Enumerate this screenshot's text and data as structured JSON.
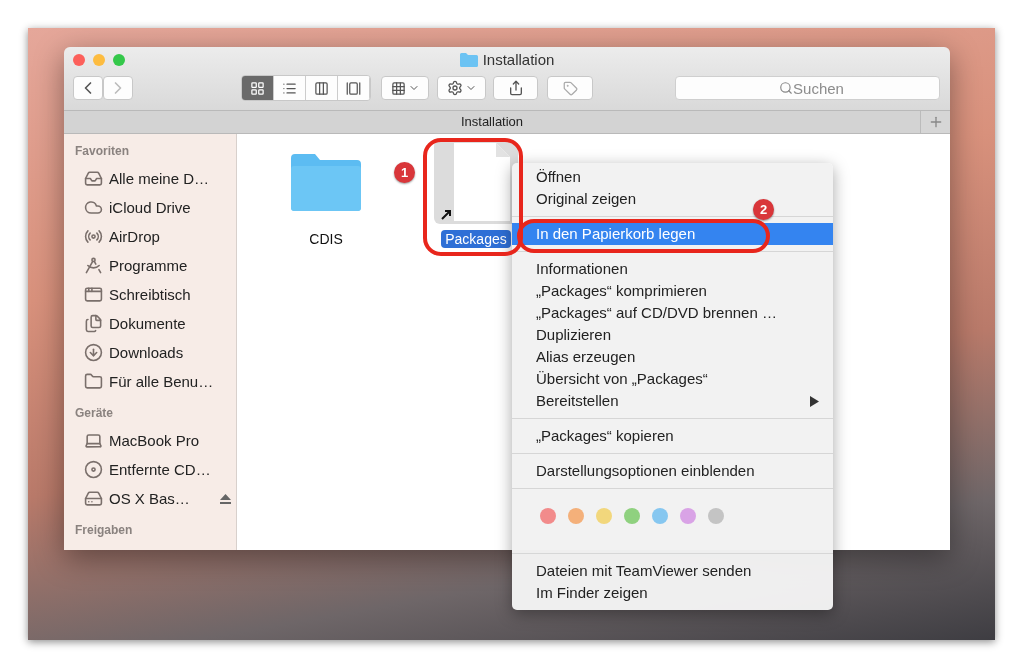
{
  "window": {
    "title": "Installation",
    "path_bar": "Installation"
  },
  "toolbar": {
    "view_buttons": [
      {
        "kind": "icons",
        "selected": true
      },
      {
        "kind": "list",
        "selected": false
      },
      {
        "kind": "columns",
        "selected": false
      },
      {
        "kind": "coverflow",
        "selected": false
      }
    ],
    "search": {
      "placeholder": "Suchen"
    }
  },
  "sidebar": {
    "sections": [
      {
        "heading": "Favoriten",
        "items": [
          {
            "label": "Alle meine D…",
            "kind": "files"
          },
          {
            "label": "iCloud Drive",
            "kind": "cloud"
          },
          {
            "label": "AirDrop",
            "kind": "airdrop"
          },
          {
            "label": "Programme",
            "kind": "apps"
          },
          {
            "label": "Schreibtisch",
            "kind": "desktop"
          },
          {
            "label": "Dokumente",
            "kind": "documents"
          },
          {
            "label": "Downloads",
            "kind": "downloads"
          },
          {
            "label": "Für alle Benu…",
            "kind": "folder"
          }
        ]
      },
      {
        "heading": "Geräte",
        "items": [
          {
            "label": "MacBook Pro",
            "kind": "laptop"
          },
          {
            "label": "Entfernte CD…",
            "kind": "disc"
          },
          {
            "label": "OS X Bas…",
            "kind": "drive",
            "eject": true
          }
        ]
      },
      {
        "heading": "Freigaben"
      }
    ]
  },
  "files": [
    {
      "name": "CDIS",
      "kind": "folder",
      "selected": false
    },
    {
      "name": "Packages",
      "kind": "alias",
      "selected": true
    }
  ],
  "context_menu": {
    "groups": [
      [
        {
          "label": "Öffnen",
          "highlighted": false
        },
        {
          "label": "Original zeigen",
          "highlighted": false
        }
      ],
      [
        {
          "label": "In den Papierkorb legen",
          "highlighted": true
        }
      ],
      [
        {
          "label": "Informationen",
          "highlighted": false
        },
        {
          "label": "„Packages“ komprimieren",
          "highlighted": false
        },
        {
          "label": "„Packages“ auf CD/DVD brennen …",
          "highlighted": false
        },
        {
          "label": "Duplizieren",
          "highlighted": false
        },
        {
          "label": "Alias erzeugen",
          "highlighted": false
        },
        {
          "label": "Übersicht von „Packages“",
          "highlighted": false
        },
        {
          "label": "Bereitstellen",
          "highlighted": false,
          "submenu": true
        }
      ],
      [
        {
          "label": "„Packages“ kopieren",
          "highlighted": false
        }
      ],
      [
        {
          "label": "Darstellungsoptionen einblenden",
          "highlighted": false
        }
      ]
    ],
    "tags": [
      {
        "color": "#f28b8b"
      },
      {
        "color": "#f4b07a"
      },
      {
        "color": "#f2d77c"
      },
      {
        "color": "#8fd17f"
      },
      {
        "color": "#86c7f0"
      },
      {
        "color": "#d9a3e6"
      },
      {
        "color": "#c4c4c4"
      }
    ],
    "footer_items": [
      {
        "label": "Dateien mit TeamViewer senden",
        "highlighted": false
      },
      {
        "label": "Im Finder zeigen",
        "highlighted": false
      }
    ]
  },
  "annotations": [
    {
      "number": "1"
    },
    {
      "number": "2"
    }
  ]
}
